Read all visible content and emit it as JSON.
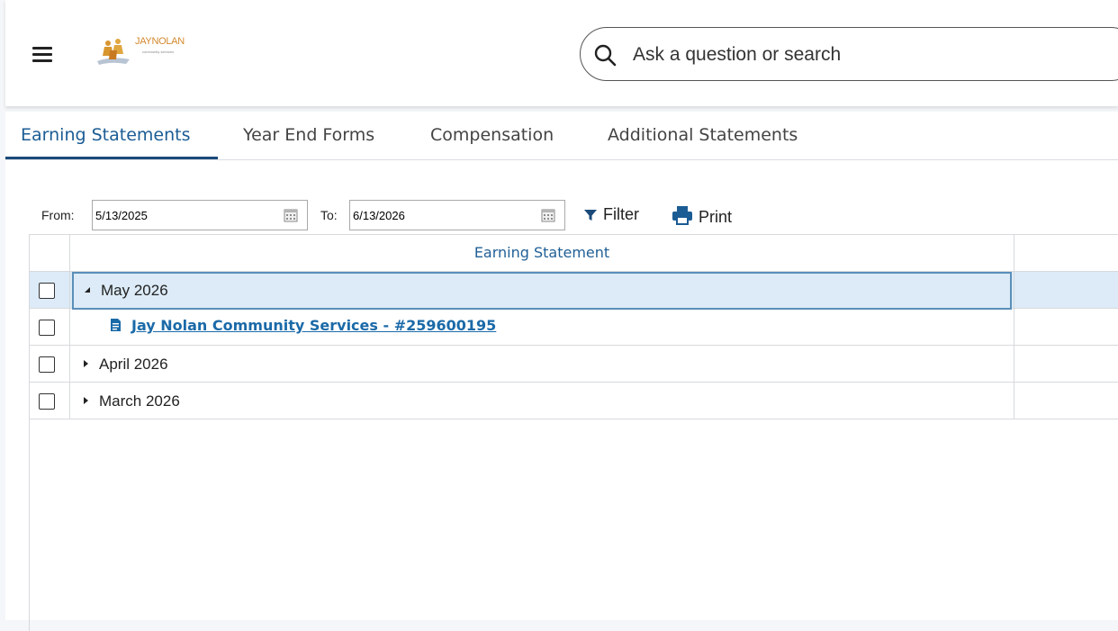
{
  "header": {
    "logo_text": "JAYNOLAN",
    "logo_subtext": "community services",
    "search_placeholder": "Ask a question or search"
  },
  "tabs": [
    {
      "label": "Earning Statements",
      "active": true
    },
    {
      "label": "Year End Forms",
      "active": false
    },
    {
      "label": "Compensation",
      "active": false
    },
    {
      "label": "Additional Statements",
      "active": false
    }
  ],
  "filters": {
    "from_label": "From:",
    "from_value": "5/13/2025",
    "to_label": "To:",
    "to_value": "6/13/2026",
    "filter_label": "Filter",
    "print_label": "Print"
  },
  "grid": {
    "column_title": "Earning Statement",
    "rows": [
      {
        "label": "May 2026",
        "expanded": true,
        "selected": true
      },
      {
        "label": "Jay Nolan Community Services - #259600195",
        "type": "document"
      },
      {
        "label": "April 2026",
        "expanded": false
      },
      {
        "label": "March 2026",
        "expanded": false
      }
    ]
  },
  "colors": {
    "accent": "#1b5c94",
    "link": "#1b6aa8",
    "selected_row": "#dcebf7"
  }
}
